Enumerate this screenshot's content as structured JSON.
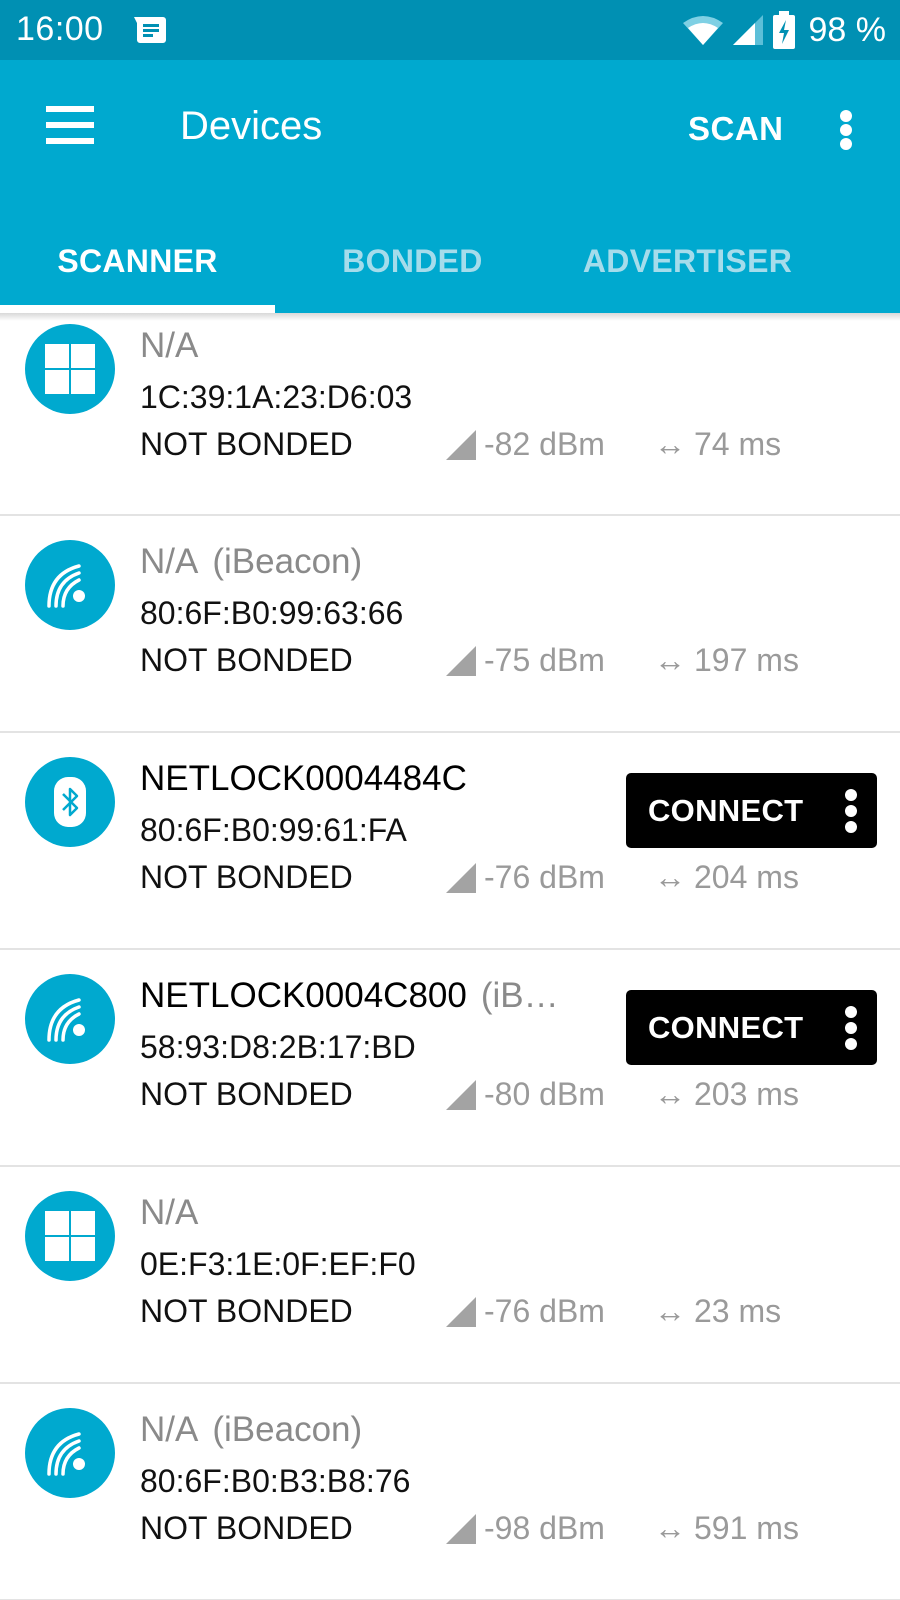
{
  "status_bar": {
    "time": "16:00",
    "notification_icon": "message-icon",
    "wifi_icon": "wifi-icon",
    "signal_icon": "cell-signal-icon",
    "battery_icon": "battery-charging-icon",
    "battery_percent": "98 %"
  },
  "app_bar": {
    "menu_icon": "hamburger-menu-icon",
    "title": "Devices",
    "scan_label": "SCAN",
    "overflow_icon": "more-vert-icon",
    "colors": {
      "primary": "#00a9cf",
      "status_bar": "#0090b3"
    }
  },
  "tabs": [
    {
      "label": "SCANNER",
      "active": true
    },
    {
      "label": "BONDED",
      "active": false
    },
    {
      "label": "ADVERTISER",
      "active": false
    }
  ],
  "devices": [
    {
      "icon": "grid-icon",
      "name": "N/A",
      "type": "",
      "address": "1C:39:1A:23:D6:03",
      "bond_state": "NOT BONDED",
      "rssi": "-82 dBm",
      "interval": "74 ms",
      "connectable": false
    },
    {
      "icon": "beacon-icon",
      "name": "N/A",
      "type": "(iBeacon)",
      "address": "80:6F:B0:99:63:66",
      "bond_state": "NOT BONDED",
      "rssi": "-75 dBm",
      "interval": "197 ms",
      "connectable": false
    },
    {
      "icon": "bluetooth-icon",
      "name": "NETLOCK0004484C",
      "type": "",
      "address": "80:6F:B0:99:61:FA",
      "bond_state": "NOT BONDED",
      "rssi": "-76 dBm",
      "interval": "204 ms",
      "connectable": true,
      "connect_label": "CONNECT"
    },
    {
      "icon": "beacon-icon",
      "name": "NETLOCK0004C800",
      "type": "(iB…",
      "address": "58:93:D8:2B:17:BD",
      "bond_state": "NOT BONDED",
      "rssi": "-80 dBm",
      "interval": "203 ms",
      "connectable": true,
      "connect_label": "CONNECT"
    },
    {
      "icon": "grid-icon",
      "name": "N/A",
      "type": "",
      "address": "0E:F3:1E:0F:EF:F0",
      "bond_state": "NOT BONDED",
      "rssi": "-76 dBm",
      "interval": "23 ms",
      "connectable": false
    },
    {
      "icon": "beacon-icon",
      "name": "N/A",
      "type": "(iBeacon)",
      "address": "80:6F:B0:B3:B8:76",
      "bond_state": "NOT BONDED",
      "rssi": "-98 dBm",
      "interval": "591 ms",
      "connectable": false
    }
  ],
  "interval_glyph": "↔"
}
